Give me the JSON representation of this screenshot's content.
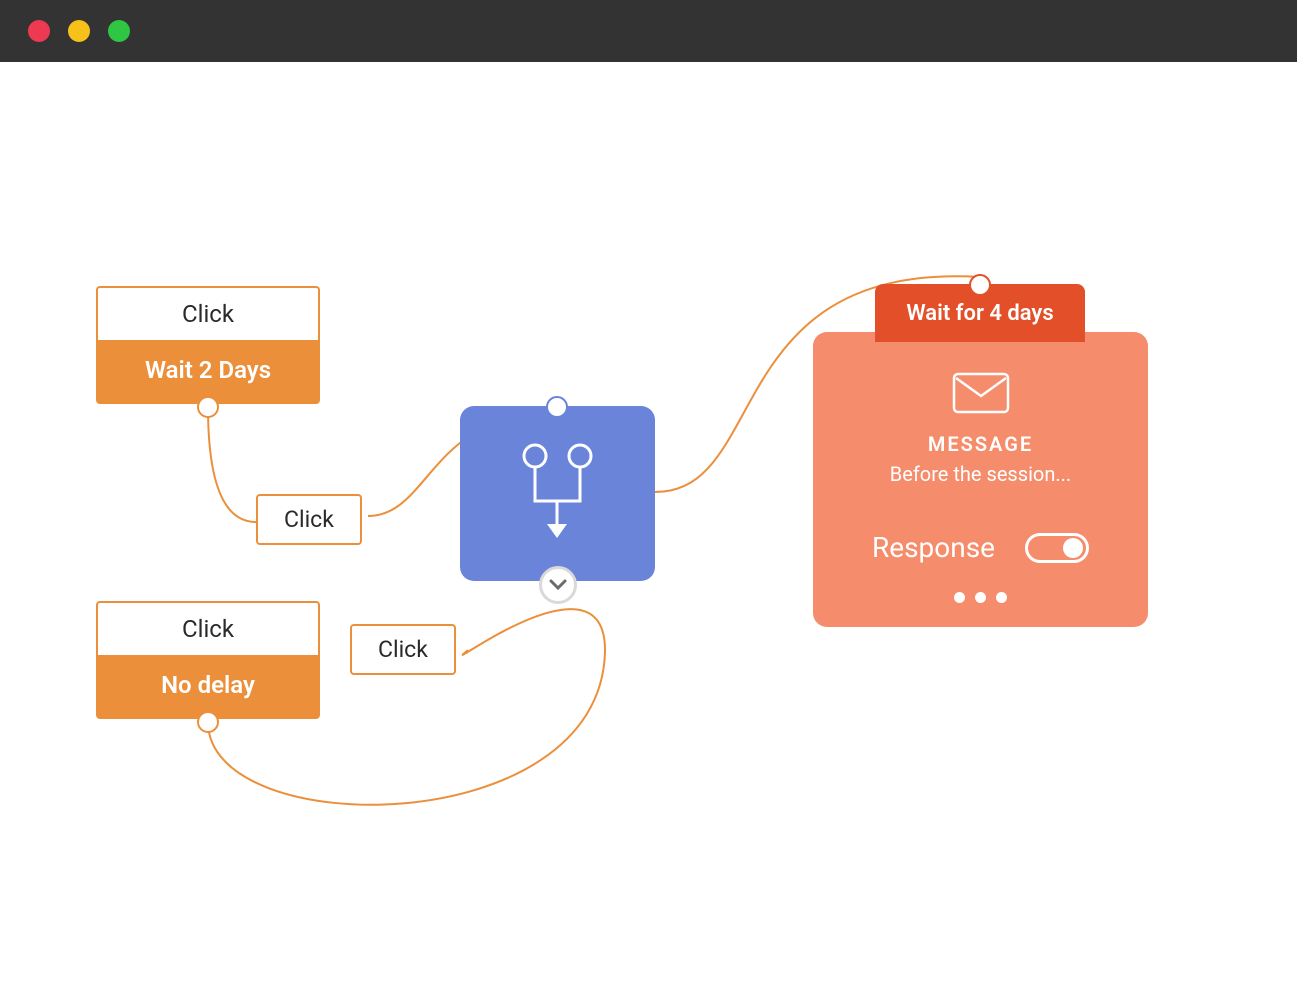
{
  "nodes": {
    "wait2": {
      "header": "Click",
      "body": "Wait 2 Days"
    },
    "nodelay": {
      "header": "Click",
      "body": "No delay"
    }
  },
  "clickbox1": "Click",
  "clickbox2": "Click",
  "wait4_tab": "Wait for 4 days",
  "message": {
    "title": "MESSAGE",
    "subtitle": "Before the session...",
    "response_label": "Response",
    "toggle_on": true
  },
  "colors": {
    "orange": "#eb8f3b",
    "blue": "#6a84da",
    "salmon": "#f58c6b",
    "deep_orange": "#e24f29",
    "titlebar": "#333333"
  }
}
